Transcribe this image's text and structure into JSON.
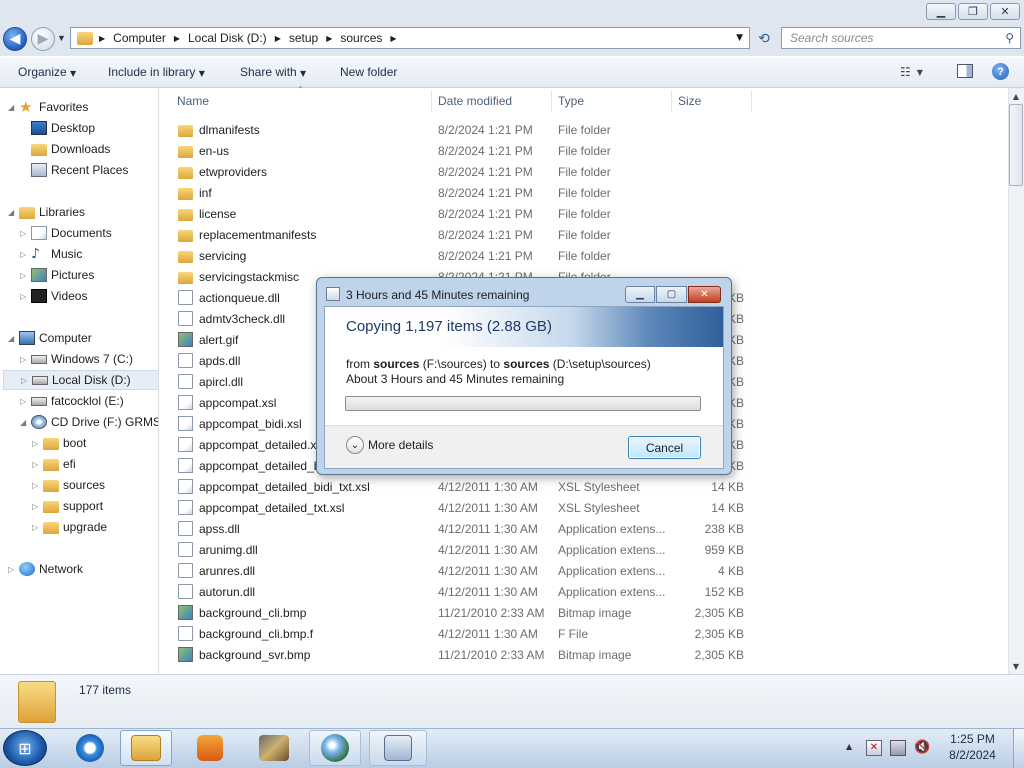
{
  "address": {
    "crumbs": [
      "Computer",
      "Local Disk (D:)",
      "setup",
      "sources"
    ]
  },
  "search": {
    "placeholder": "Search sources"
  },
  "toolbar": {
    "organize": "Organize",
    "include": "Include in library",
    "share": "Share with",
    "new_folder": "New folder"
  },
  "nav": {
    "favorites": "Favorites",
    "desktop": "Desktop",
    "downloads": "Downloads",
    "recent": "Recent Places",
    "libraries": "Libraries",
    "documents": "Documents",
    "music": "Music",
    "pictures": "Pictures",
    "videos": "Videos",
    "computer": "Computer",
    "win7": "Windows 7 (C:)",
    "locald": "Local Disk (D:)",
    "fatcock": "fatcocklol (E:)",
    "cddrive": "CD Drive (F:) GRMSXF",
    "boot": "boot",
    "efi": "efi",
    "sources": "sources",
    "support": "support",
    "upgrade": "upgrade",
    "network": "Network"
  },
  "columns": {
    "name": "Name",
    "date": "Date modified",
    "type": "Type",
    "size": "Size"
  },
  "files": [
    {
      "name": "dlmanifests",
      "date": "8/2/2024 1:21 PM",
      "type": "File folder",
      "size": "",
      "kind": "folder"
    },
    {
      "name": "en-us",
      "date": "8/2/2024 1:21 PM",
      "type": "File folder",
      "size": "",
      "kind": "folder"
    },
    {
      "name": "etwproviders",
      "date": "8/2/2024 1:21 PM",
      "type": "File folder",
      "size": "",
      "kind": "folder"
    },
    {
      "name": "inf",
      "date": "8/2/2024 1:21 PM",
      "type": "File folder",
      "size": "",
      "kind": "folder"
    },
    {
      "name": "license",
      "date": "8/2/2024 1:21 PM",
      "type": "File folder",
      "size": "",
      "kind": "folder"
    },
    {
      "name": "replacementmanifests",
      "date": "8/2/2024 1:21 PM",
      "type": "File folder",
      "size": "",
      "kind": "folder"
    },
    {
      "name": "servicing",
      "date": "8/2/2024 1:21 PM",
      "type": "File folder",
      "size": "",
      "kind": "folder"
    },
    {
      "name": "servicingstackmisc",
      "date": "8/2/2024 1:21 PM",
      "type": "File folder",
      "size": "",
      "kind": "folder"
    },
    {
      "name": "actionqueue.dll",
      "date": "",
      "type": "",
      "size": "KB",
      "kind": "doc"
    },
    {
      "name": "admtv3check.dll",
      "date": "",
      "type": "",
      "size": "KB",
      "kind": "doc"
    },
    {
      "name": "alert.gif",
      "date": "",
      "type": "",
      "size": "KB",
      "kind": "img"
    },
    {
      "name": "apds.dll",
      "date": "",
      "type": "",
      "size": "KB",
      "kind": "doc"
    },
    {
      "name": "apircl.dll",
      "date": "",
      "type": "",
      "size": "KB",
      "kind": "doc"
    },
    {
      "name": "appcompat.xsl",
      "date": "",
      "type": "",
      "size": "KB",
      "kind": "docx"
    },
    {
      "name": "appcompat_bidi.xsl",
      "date": "",
      "type": "",
      "size": "KB",
      "kind": "docx"
    },
    {
      "name": "appcompat_detailed.xs",
      "date": "",
      "type": "",
      "size": "KB",
      "kind": "docx"
    },
    {
      "name": "appcompat_detailed_b",
      "date": "",
      "type": "",
      "size": "KB",
      "kind": "docx"
    },
    {
      "name": "appcompat_detailed_bidi_txt.xsl",
      "date": "4/12/2011 1:30 AM",
      "type": "XSL Stylesheet",
      "size": "14 KB",
      "kind": "docx"
    },
    {
      "name": "appcompat_detailed_txt.xsl",
      "date": "4/12/2011 1:30 AM",
      "type": "XSL Stylesheet",
      "size": "14 KB",
      "kind": "docx"
    },
    {
      "name": "apss.dll",
      "date": "4/12/2011 1:30 AM",
      "type": "Application extens...",
      "size": "238 KB",
      "kind": "doc"
    },
    {
      "name": "arunimg.dll",
      "date": "4/12/2011 1:30 AM",
      "type": "Application extens...",
      "size": "959 KB",
      "kind": "doc"
    },
    {
      "name": "arunres.dll",
      "date": "4/12/2011 1:30 AM",
      "type": "Application extens...",
      "size": "4 KB",
      "kind": "doc"
    },
    {
      "name": "autorun.dll",
      "date": "4/12/2011 1:30 AM",
      "type": "Application extens...",
      "size": "152 KB",
      "kind": "doc"
    },
    {
      "name": "background_cli.bmp",
      "date": "11/21/2010 2:33 AM",
      "type": "Bitmap image",
      "size": "2,305 KB",
      "kind": "img"
    },
    {
      "name": "background_cli.bmp.f",
      "date": "4/12/2011 1:30 AM",
      "type": "F File",
      "size": "2,305 KB",
      "kind": "blank"
    },
    {
      "name": "background_svr.bmp",
      "date": "11/21/2010 2:33 AM",
      "type": "Bitmap image",
      "size": "2,305 KB",
      "kind": "img"
    }
  ],
  "details": {
    "count": "177 items"
  },
  "dialog": {
    "title": "3 Hours and 45 Minutes remaining",
    "main": "Copying 1,197 items (2.88 GB)",
    "from_prefix": "from ",
    "from_src": "sources",
    "from_mid": " (F:\\sources) to ",
    "from_dst": "sources",
    "from_tail": " (D:\\setup\\sources)",
    "about": "About 3 Hours and 45 Minutes remaining",
    "progress_fraction": 0.0,
    "more": "More details",
    "cancel": "Cancel"
  },
  "clock": {
    "time": "1:25 PM",
    "date": "8/2/2024"
  },
  "colors": {
    "accent": "#2b5d9c",
    "progress": "#2fb52f"
  }
}
